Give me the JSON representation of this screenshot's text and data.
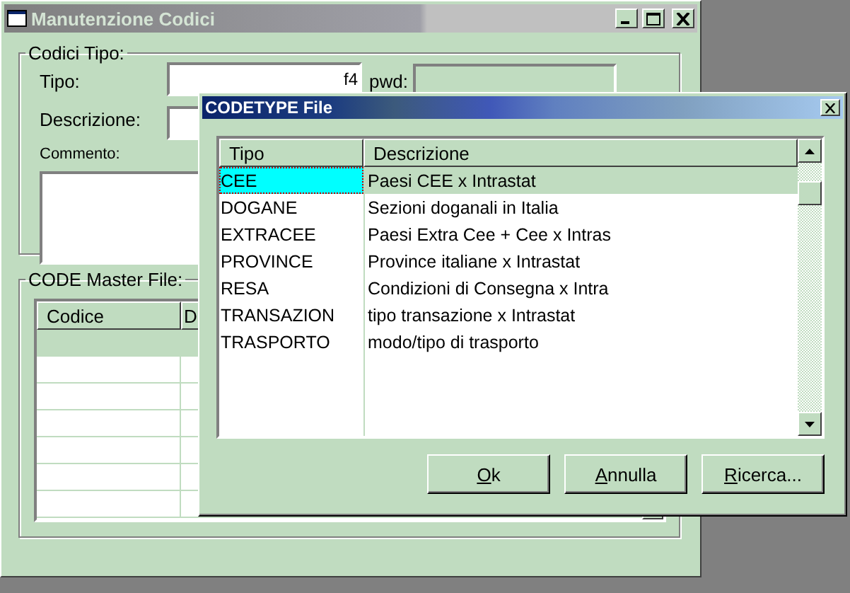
{
  "main_window": {
    "title": "Manutenzione Codici",
    "codici_tipo": {
      "legend": "Codici Tipo:",
      "tipo_label": "Tipo:",
      "tipo_key": "f4",
      "pwd_label": "pwd:",
      "descrizione_label": "Descrizione:",
      "commento_label": "Commento:"
    },
    "master": {
      "legend": "CODE Master File:",
      "columns": [
        "Codice",
        "D"
      ]
    }
  },
  "dialog": {
    "title": "CODETYPE File",
    "columns": [
      "Tipo",
      "Descrizione"
    ],
    "rows": [
      {
        "tipo": "CEE",
        "descrizione": "Paesi CEE x Intrastat",
        "selected": true
      },
      {
        "tipo": "DOGANE",
        "descrizione": "Sezioni doganali in Italia",
        "selected": false
      },
      {
        "tipo": "EXTRACEE",
        "descrizione": "Paesi Extra Cee + Cee x Intras",
        "selected": false
      },
      {
        "tipo": "PROVINCE",
        "descrizione": "Province italiane x Intrastat",
        "selected": false
      },
      {
        "tipo": "RESA",
        "descrizione": "Condizioni di Consegna x Intra",
        "selected": false
      },
      {
        "tipo": "TRANSAZION",
        "descrizione": "tipo transazione x Intrastat",
        "selected": false
      },
      {
        "tipo": "TRASPORTO",
        "descrizione": "modo/tipo di trasporto",
        "selected": false
      }
    ],
    "buttons": [
      "Ok",
      "Annulla",
      "Ricerca..."
    ]
  }
}
